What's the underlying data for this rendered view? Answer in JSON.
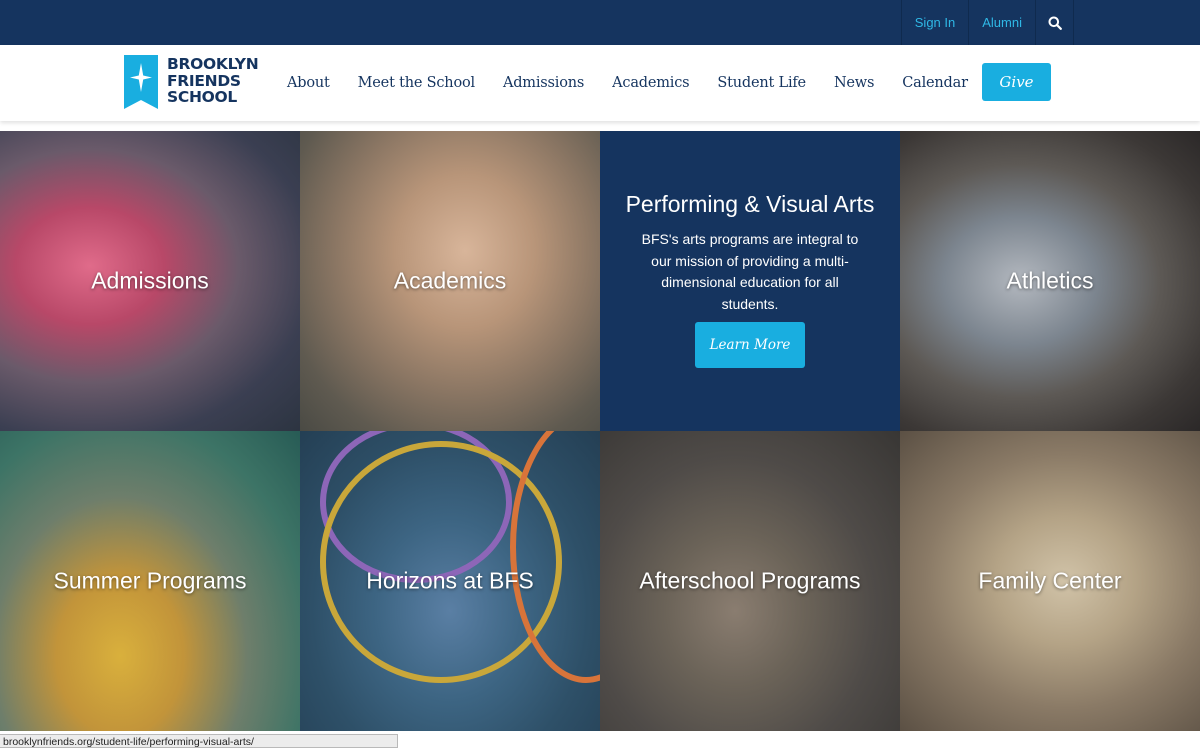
{
  "topbar": {
    "sign_in": "Sign In",
    "alumni": "Alumni",
    "search_icon": "search-icon"
  },
  "logo": {
    "line1": "BROOKLYN",
    "line2": "FRIENDS",
    "line3": "SCHOOL"
  },
  "nav": {
    "items": [
      {
        "label": "About"
      },
      {
        "label": "Meet the School"
      },
      {
        "label": "Admissions"
      },
      {
        "label": "Academics"
      },
      {
        "label": "Student Life"
      },
      {
        "label": "News"
      },
      {
        "label": "Calendar"
      }
    ],
    "give_label": "Give"
  },
  "tiles": {
    "admissions": "Admissions",
    "academics": "Academics",
    "athletics": "Athletics",
    "summer": "Summer Programs",
    "horizons": "Horizons at BFS",
    "afterschool": "Afterschool Programs",
    "family": "Family Center"
  },
  "performing": {
    "title": "Performing & Visual Arts",
    "description": "BFS's arts programs are integral to our mission of providing a multi-dimensional education for all students.",
    "button_label": "Learn More"
  },
  "statusbar": {
    "url": "brooklynfriends.org/student-life/performing-visual-arts/"
  },
  "colors": {
    "navy": "#15345f",
    "accent_blue": "#19aee0",
    "link_blue": "#2fb8e6"
  }
}
